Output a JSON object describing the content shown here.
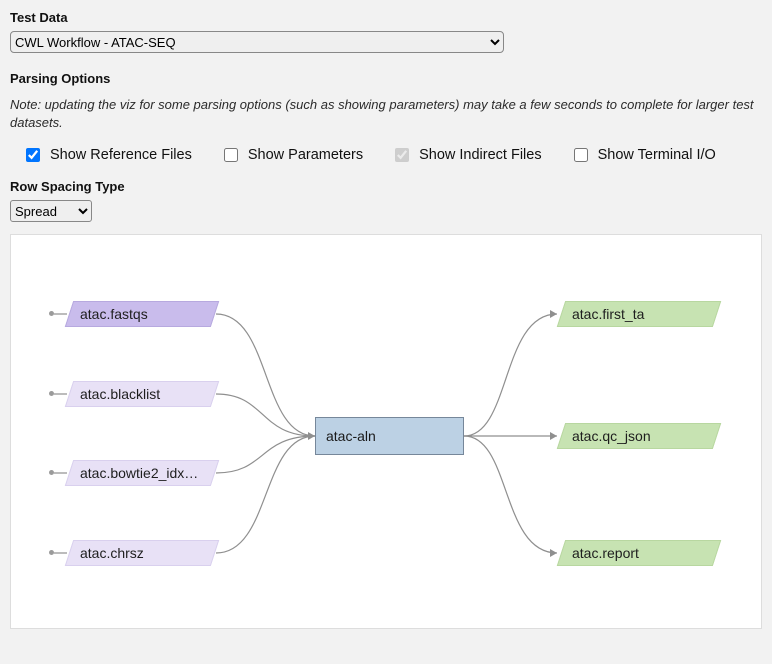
{
  "labels": {
    "test_data": "Test Data",
    "parsing_options": "Parsing Options",
    "row_spacing_type": "Row Spacing Type"
  },
  "test_data_value": "CWL Workflow - ATAC-SEQ",
  "note": "Note: updating the viz for some parsing options (such as showing parameters) may take a few seconds to complete for larger test datasets.",
  "checkboxes": {
    "show_reference_files": "Show Reference Files",
    "show_parameters": "Show Parameters",
    "show_indirect_files": "Show Indirect Files",
    "show_terminal_io": "Show Terminal I/O"
  },
  "row_spacing_value": "Spread",
  "workflow": {
    "inputs": [
      "atac.fastqs",
      "atac.blacklist",
      "atac.bowtie2_idx…",
      "atac.chrsz"
    ],
    "step": "atac-aln",
    "outputs": [
      "atac.first_ta",
      "atac.qc_json",
      "atac.report"
    ]
  }
}
